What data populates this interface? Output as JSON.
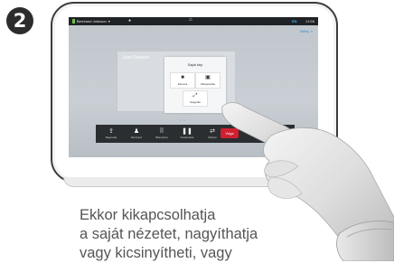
{
  "step": {
    "number": "2"
  },
  "screen": {
    "status_bar": {
      "user": "Bernhard Johnson",
      "language": "EN",
      "time": "13:56"
    },
    "end_link": "Befej. ×",
    "self_view": {
      "name": "Jane Dawson"
    },
    "selfview_menu": {
      "title": "Saját kép",
      "items": [
        {
          "icon": "camera-icon",
          "label": "Kamera"
        },
        {
          "icon": "self-view-icon",
          "label": "Kikapcsolás"
        },
        {
          "icon": "resize-icon",
          "label": "Nagyítás"
        }
      ]
    },
    "toolbar": {
      "buttons": [
        {
          "icon": "share-icon",
          "label": "Megosztás"
        },
        {
          "icon": "add-participant-icon",
          "label": "Résztvevő"
        },
        {
          "icon": "keypad-icon",
          "label": "Billentyűzet"
        },
        {
          "icon": "hold-icon",
          "label": "Várakoztatás"
        },
        {
          "icon": "transfer-icon",
          "label": "Átirányít"
        }
      ],
      "end_call_label": "Vége"
    }
  },
  "caption": {
    "lines": [
      "Ekkor kikapcsolhatja",
      "a saját nézetet, nagyíthatja",
      "vagy kicsinyítheti, vagy"
    ]
  },
  "colors": {
    "status_accent": "#6cc04a",
    "language_color": "#4aa8e0",
    "end_call": "#cf2030",
    "caption_text": "#555555"
  }
}
